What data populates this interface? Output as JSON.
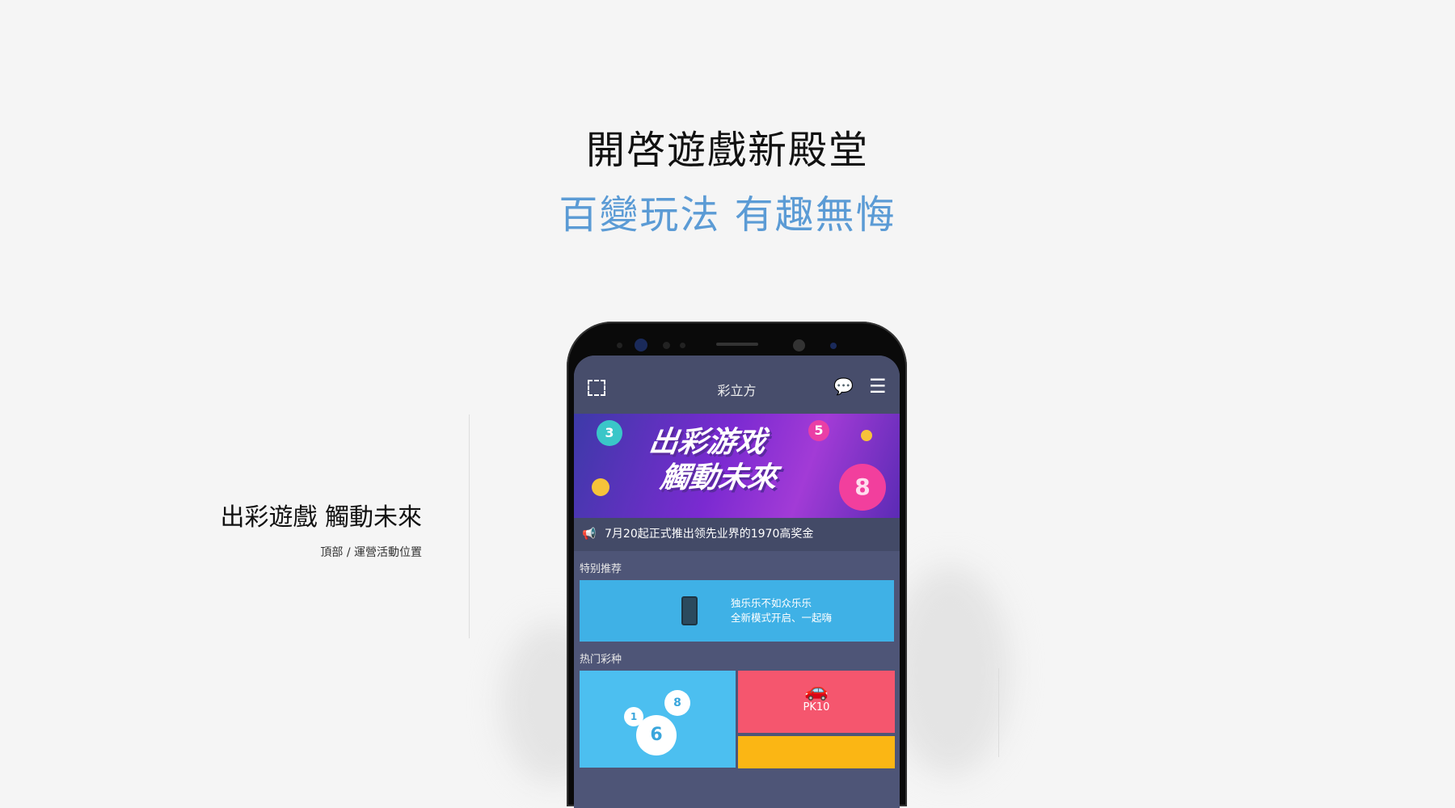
{
  "hero": {
    "title": "開啓遊戲新殿堂",
    "subtitle": "百變玩法 有趣無悔"
  },
  "side": {
    "heading": "出彩遊戲 觸動未來",
    "caption": "頂部 / 運營活動位置"
  },
  "app": {
    "title": "彩立方",
    "banner": {
      "line1": "出彩游戏",
      "line2": "觸動未來",
      "balls": [
        "3",
        "5",
        "8"
      ]
    },
    "notice": "7月20起正式推出领先业界的1970高奖金",
    "featured_label": "特别推荐",
    "featured_card": {
      "line1": "独乐乐不如众乐乐",
      "line2": "全新模式开启、一起嗨"
    },
    "hot_label": "热门彩种",
    "tiles": [
      {
        "label": "PK10"
      }
    ],
    "tile_balls": [
      "1",
      "6",
      "8"
    ],
    "colors": {
      "accent": "#5b9bd5",
      "tile_blue": "#4cbff0",
      "tile_red": "#f5566e",
      "tile_yellow": "#fbb614"
    }
  }
}
